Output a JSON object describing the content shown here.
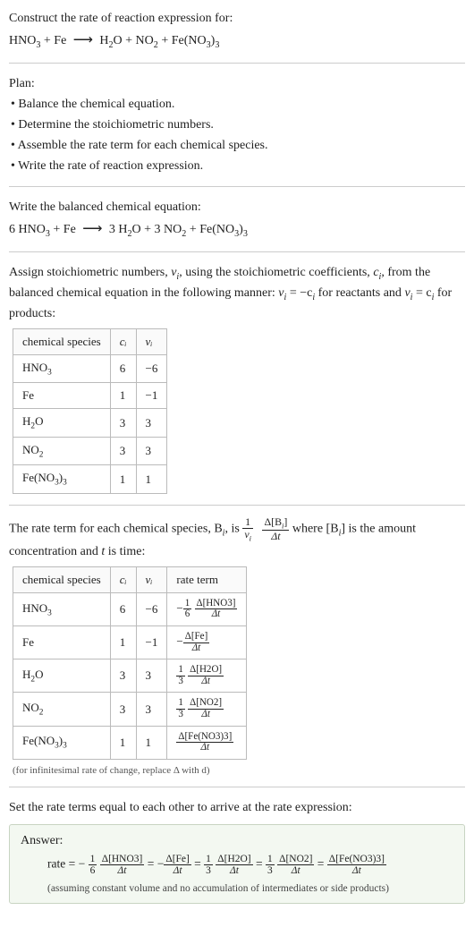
{
  "prompt": {
    "title": "Construct the rate of reaction expression for:",
    "eq_lhs1": "HNO",
    "eq_lhs1_sub": "3",
    "plus1": " + Fe ",
    "arrow": "⟶",
    "eq_rhs1": " H",
    "eq_rhs1_sub": "2",
    "eq_rhs2": "O + NO",
    "eq_rhs2_sub": "2",
    "eq_rhs3": " + Fe(NO",
    "eq_rhs3_sub": "3",
    "eq_rhs4": ")",
    "eq_rhs4_sub": "3"
  },
  "plan": {
    "heading": "Plan:",
    "b1": "• Balance the chemical equation.",
    "b2": "• Determine the stoichiometric numbers.",
    "b3": "• Assemble the rate term for each chemical species.",
    "b4": "• Write the rate of reaction expression."
  },
  "balanced": {
    "heading": "Write the balanced chemical equation:",
    "c1": "6 HNO",
    "c1s": "3",
    "c2": " + Fe ",
    "arrow": "⟶",
    "c3": " 3 H",
    "c3s": "2",
    "c4": "O + 3 NO",
    "c4s": "2",
    "c5": " + Fe(NO",
    "c5s": "3",
    "c6": ")",
    "c6s": "3"
  },
  "stoich": {
    "intro1": "Assign stoichiometric numbers, ",
    "nu_i": "ν",
    "nu_i_sub": "i",
    "intro2": ", using the stoichiometric coefficients, ",
    "c_i": "c",
    "c_i_sub": "i",
    "intro3": ", from the balanced chemical equation in the following manner: ",
    "rel1a": "ν",
    "rel1b": "i",
    "rel1c": " = −c",
    "rel1d": "i",
    "rel1e": " for reactants and ",
    "rel2a": "ν",
    "rel2b": "i",
    "rel2c": " = c",
    "rel2d": "i",
    "rel2e": " for products:",
    "th_species": "chemical species",
    "th_ci": "cᵢ",
    "th_nui": "νᵢ",
    "rows": [
      {
        "sp_a": "HNO",
        "sp_sub": "3",
        "sp_b": "",
        "ci": "6",
        "nui": "−6"
      },
      {
        "sp_a": "Fe",
        "sp_sub": "",
        "sp_b": "",
        "ci": "1",
        "nui": "−1"
      },
      {
        "sp_a": "H",
        "sp_sub": "2",
        "sp_b": "O",
        "ci": "3",
        "nui": "3"
      },
      {
        "sp_a": "NO",
        "sp_sub": "2",
        "sp_b": "",
        "ci": "3",
        "nui": "3"
      },
      {
        "sp_a": "Fe(NO",
        "sp_sub": "3",
        "sp_b": ")",
        "sp_sub2": "3",
        "ci": "1",
        "nui": "1"
      }
    ]
  },
  "rateterm": {
    "intro_a": "The rate term for each chemical species, B",
    "intro_b": "i",
    "intro_c": ", is ",
    "big_frac_1_num": "1",
    "big_frac_1_den_a": "ν",
    "big_frac_1_den_b": "i",
    "big_frac_2_num_a": "Δ[B",
    "big_frac_2_num_b": "i",
    "big_frac_2_num_c": "]",
    "big_frac_2_den": "Δt",
    "intro_d": " where [B",
    "intro_e": "i",
    "intro_f": "] is the amount concentration and ",
    "t_var": "t",
    "intro_g": " is time:",
    "th_species": "chemical species",
    "th_ci": "cᵢ",
    "th_nui": "νᵢ",
    "th_rate": "rate term",
    "rows": [
      {
        "sp_a": "HNO",
        "sp_sub": "3",
        "sp_b": "",
        "ci": "6",
        "nui": "−6",
        "neg": "−",
        "coef_num": "1",
        "coef_den": "6",
        "d_num": "Δ[HNO3]",
        "d_den": "Δt"
      },
      {
        "sp_a": "Fe",
        "sp_sub": "",
        "sp_b": "",
        "ci": "1",
        "nui": "−1",
        "neg": "−",
        "coef_num": "",
        "coef_den": "",
        "d_num": "Δ[Fe]",
        "d_den": "Δt"
      },
      {
        "sp_a": "H",
        "sp_sub": "2",
        "sp_b": "O",
        "ci": "3",
        "nui": "3",
        "neg": "",
        "coef_num": "1",
        "coef_den": "3",
        "d_num": "Δ[H2O]",
        "d_den": "Δt"
      },
      {
        "sp_a": "NO",
        "sp_sub": "2",
        "sp_b": "",
        "ci": "3",
        "nui": "3",
        "neg": "",
        "coef_num": "1",
        "coef_den": "3",
        "d_num": "Δ[NO2]",
        "d_den": "Δt"
      },
      {
        "sp_a": "Fe(NO",
        "sp_sub": "3",
        "sp_b": ")",
        "sp_sub2": "3",
        "ci": "1",
        "nui": "1",
        "neg": "",
        "coef_num": "",
        "coef_den": "",
        "d_num": "Δ[Fe(NO3)3]",
        "d_den": "Δt"
      }
    ],
    "note": "(for infinitesimal rate of change, replace Δ with d)"
  },
  "conclusion": {
    "lead": "Set the rate terms equal to each other to arrive at the rate expression:",
    "ans_label": "Answer:",
    "rate_eq_prefix": "rate = −",
    "f1_num": "1",
    "f1_den": "6",
    "d1_num": "Δ[HNO3]",
    "d1_den": "Δt",
    "eq": " = ",
    "neg2": "−",
    "d2_num": "Δ[Fe]",
    "d2_den": "Δt",
    "f3_num": "1",
    "f3_den": "3",
    "d3_num": "Δ[H2O]",
    "d3_den": "Δt",
    "f4_num": "1",
    "f4_den": "3",
    "d4_num": "Δ[NO2]",
    "d4_den": "Δt",
    "d5_num": "Δ[Fe(NO3)3]",
    "d5_den": "Δt",
    "assume": "(assuming constant volume and no accumulation of intermediates or side products)"
  }
}
